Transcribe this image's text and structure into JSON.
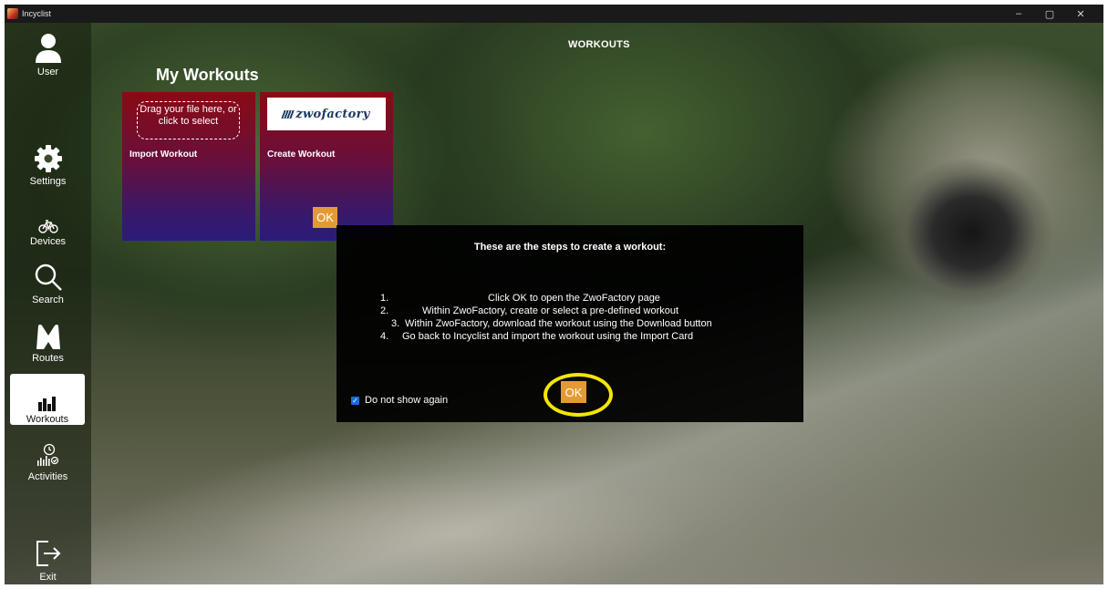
{
  "window": {
    "title": "Incyclist",
    "controls": {
      "minimize": "–",
      "maximize": "▢",
      "close": "✕"
    }
  },
  "sidebar": {
    "items": [
      {
        "label": "User",
        "icon": "user-icon"
      },
      {
        "label": "Settings",
        "icon": "gear-icon"
      },
      {
        "label": "Devices",
        "icon": "bicycle-icon"
      },
      {
        "label": "Search",
        "icon": "search-icon"
      },
      {
        "label": "Routes",
        "icon": "routes-icon"
      },
      {
        "label": "Workouts",
        "icon": "workouts-icon",
        "active": true
      },
      {
        "label": "Activities",
        "icon": "activities-icon"
      },
      {
        "label": "Exit",
        "icon": "exit-icon"
      }
    ]
  },
  "page": {
    "title": "WORKOUTS",
    "section_title": "My Workouts"
  },
  "cards": {
    "import": {
      "dropzone_text": "Drag your file here, or click to select",
      "label": "Import Workout"
    },
    "create": {
      "logo_text": "zwofactory",
      "label": "Create Workout",
      "ok_label": "OK"
    }
  },
  "modal": {
    "heading": "These are the steps to create a workout:",
    "steps": [
      {
        "num": "1.",
        "text": "Click OK to open the ZwoFactory page"
      },
      {
        "num": "2.",
        "text": "Within ZwoFactory, create or select a pre-defined workout"
      },
      {
        "num": "3.",
        "text": "Within ZwoFactory, download the workout using the Download button"
      },
      {
        "num": "4.",
        "text": "Go back to Incyclist and import the workout using the Import Card"
      }
    ],
    "checkbox_label": "Do not show again",
    "checkbox_checked": true,
    "ok_label": "OK"
  },
  "colors": {
    "accent": "#e39a36",
    "highlight": "#f3e600",
    "card_top": "#8a0a14",
    "card_bottom": "#2a1c7a"
  }
}
